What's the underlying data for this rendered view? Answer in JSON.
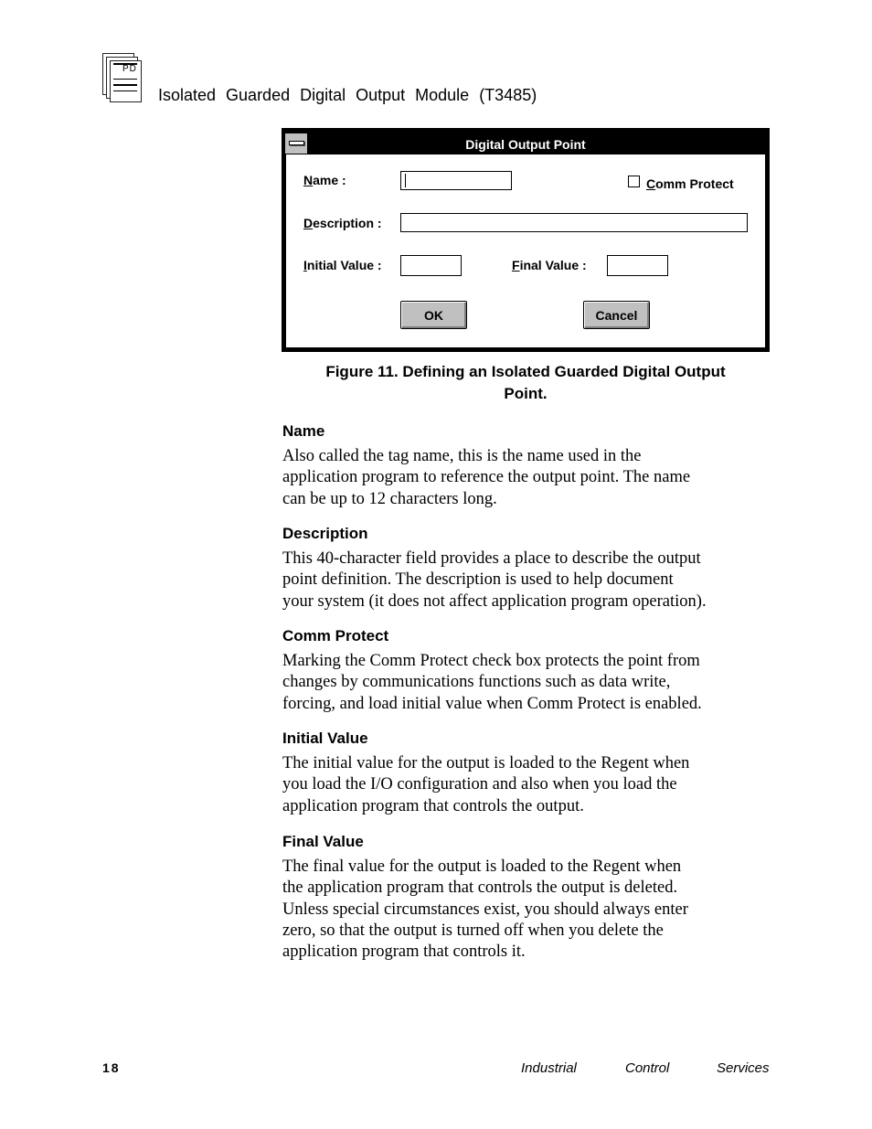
{
  "header": {
    "icon": "pd-document-stack-icon",
    "icon_text": "PD",
    "title": "Isolated Guarded Digital Output Module (T3485)"
  },
  "dialog": {
    "title": "Digital Output Point",
    "system_menu_icon": "system-menu-dash-icon",
    "name_label_accel": "N",
    "name_label_rest": "ame :",
    "name_value": "",
    "comm_protect_label_accel": "C",
    "comm_protect_label_rest": "omm Protect",
    "comm_protect_checked": false,
    "description_label_accel": "D",
    "description_label_rest": "escription :",
    "description_value": "",
    "initial_value_label_accel": "I",
    "initial_value_label_rest": "nitial Value :",
    "initial_value": "",
    "final_value_label_accel": "F",
    "final_value_label_rest": "inal Value :",
    "final_value": "",
    "ok_label": "OK",
    "cancel_label": "Cancel"
  },
  "caption": {
    "line1": "Figure 11.  Defining an Isolated Guarded Digital Output",
    "line2": "Point."
  },
  "sections": [
    {
      "heading": "Name",
      "body": "Also called the tag name, this is the name used in the\napplication program to reference the output point.  The name\ncan be up to 12 characters long."
    },
    {
      "heading": "Description",
      "body": "This 40-character field provides a place to describe the output\npoint definition.  The description is used to help document\nyour system (it does not affect application program operation)."
    },
    {
      "heading": "Comm Protect",
      "body": "Marking the Comm Protect check box protects the point from\nchanges by communications functions such as data write,\nforcing, and load initial value when Comm Protect is enabled."
    },
    {
      "heading": "Initial Value",
      "body": "The initial value for the output is loaded to the Regent when\nyou load the I/O configuration and also when you load the\napplication program that controls the output."
    },
    {
      "heading": "Final Value",
      "body": "The final value for the output is loaded to the Regent when\nthe application program that controls the output is deleted.\nUnless special circumstances exist, you should always enter\nzero, so that the output is turned off when you delete the\napplication program that controls it."
    }
  ],
  "footer": {
    "page_number": "18",
    "company": [
      "Industrial",
      "Control",
      "Services"
    ]
  }
}
